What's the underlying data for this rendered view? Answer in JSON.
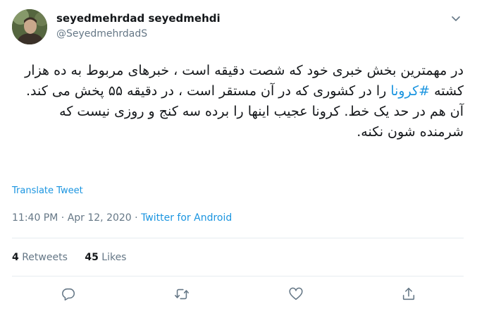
{
  "author": {
    "display_name": "seyedmehrdad seyedmehdi",
    "handle": "@SeyedmehrdadS"
  },
  "tweet": {
    "text_before": "در مهمترین بخش خبری خود که شصت دقیقه است ، خبرهای مربوط به ده هزار کشته ",
    "hashtag": "#کرونا",
    "text_after": " را در کشوری که در آن مستقر است ، در دقیقه ۵۵ پخش می کند. آن هم در حد یک خط. کرونا عجیب اینها را برده سه کنج و روزی نیست که شرمنده شون نکنه."
  },
  "translate_label": "Translate Tweet",
  "meta": {
    "time": "11:40 PM",
    "separator": " · ",
    "date": "Apr 12, 2020",
    "source": "Twitter for Android"
  },
  "stats": {
    "retweets_count": "4",
    "retweets_label": "Retweets",
    "likes_count": "45",
    "likes_label": "Likes"
  },
  "icons": {
    "caret": "chevron-down-icon",
    "reply": "reply-icon",
    "retweet": "retweet-icon",
    "like": "heart-icon",
    "share": "share-icon"
  },
  "colors": {
    "link": "#1b95e0",
    "secondary_text": "#657786",
    "primary_text": "#14171a",
    "icon": "#657786"
  }
}
